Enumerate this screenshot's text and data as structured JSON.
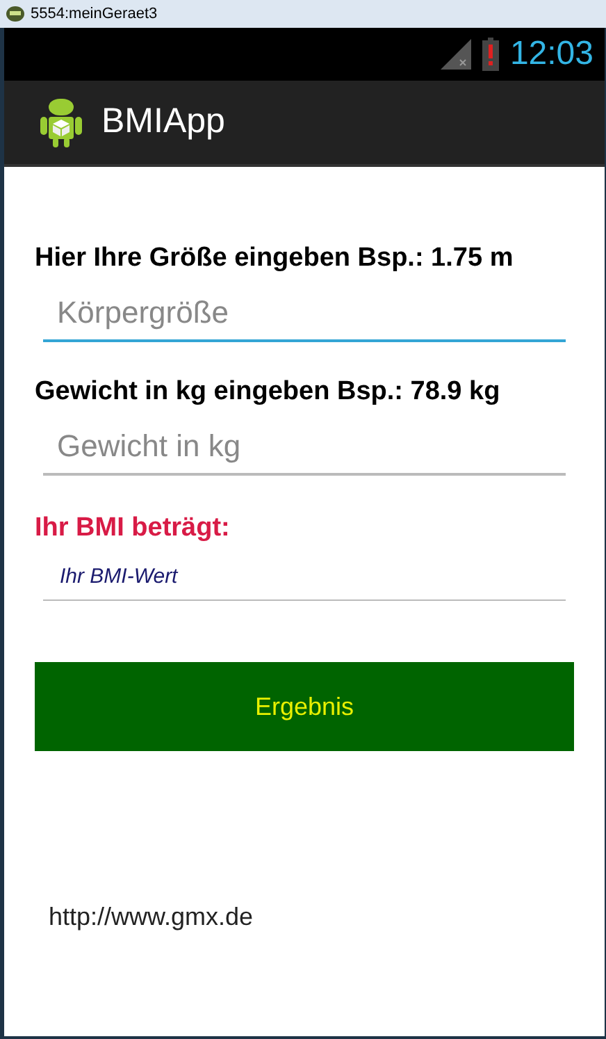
{
  "window": {
    "title": "5554:meinGeraet3"
  },
  "status_bar": {
    "time": "12:03"
  },
  "action_bar": {
    "title": "BMIApp"
  },
  "form": [
    {
      "kind": "label",
      "text": "Hier Ihre Größe eingeben Bsp.: 1.75 m"
    },
    {
      "kind": "field",
      "placeholder": "Körpergröße",
      "focused": true
    },
    {
      "kind": "label",
      "text": "Gewicht in kg eingeben Bsp.: 78.9 kg"
    },
    {
      "kind": "field",
      "placeholder": "Gewicht in kg",
      "focused": false
    },
    {
      "kind": "result_label",
      "text": "Ihr BMI beträgt:"
    },
    {
      "kind": "result_field",
      "placeholder": "Ihr BMI-Wert"
    }
  ],
  "button": {
    "label": "Ergebnis"
  },
  "link": "http://www.gmx.de"
}
